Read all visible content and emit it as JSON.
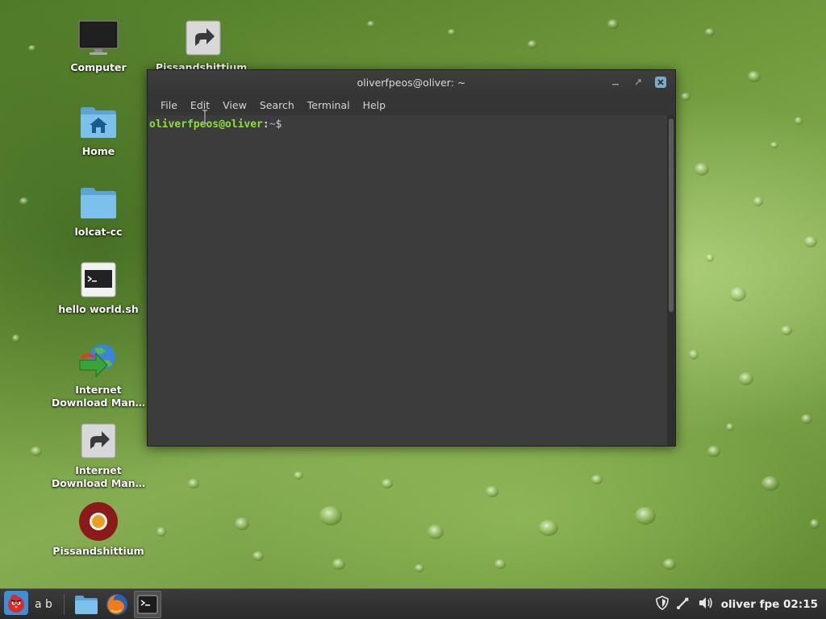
{
  "desktop": {
    "icons": [
      {
        "label": "Computer",
        "icon": "monitor-icon"
      },
      {
        "label": "Pissandshittium.",
        "icon": "shortcut-arrow-icon"
      },
      {
        "label": "Home",
        "icon": "home-folder-icon"
      },
      {
        "label": "lolcat-cc",
        "icon": "folder-icon"
      },
      {
        "label": "hello world.sh",
        "icon": "terminal-script-icon"
      },
      {
        "label": "Internet Download Man…",
        "icon": "idm-globe-icon"
      },
      {
        "label": "Internet Download Man…",
        "icon": "shortcut-arrow-icon"
      },
      {
        "label": "Pissandshittium",
        "icon": "chromium-icon"
      }
    ]
  },
  "terminal": {
    "title": "oliverfpeos@oliver: ~",
    "menu": [
      "File",
      "Edit",
      "View",
      "Search",
      "Terminal",
      "Help"
    ],
    "prompt": {
      "user": "oliverfpeos@oliver",
      "sep": ":",
      "path": "~",
      "symbol": "$"
    }
  },
  "taskbar": {
    "start_label": "a b",
    "apps": [
      {
        "name": "file-manager",
        "icon": "folder-icon"
      },
      {
        "name": "firefox",
        "icon": "firefox-icon"
      },
      {
        "name": "terminal",
        "icon": "terminal-icon"
      }
    ],
    "tray": {
      "user": "oliver fpe",
      "clock": "02:15"
    }
  },
  "colors": {
    "prompt_user": "#8ae234",
    "prompt_path": "#729fcf",
    "terminal_bg": "#3c3c3c"
  }
}
